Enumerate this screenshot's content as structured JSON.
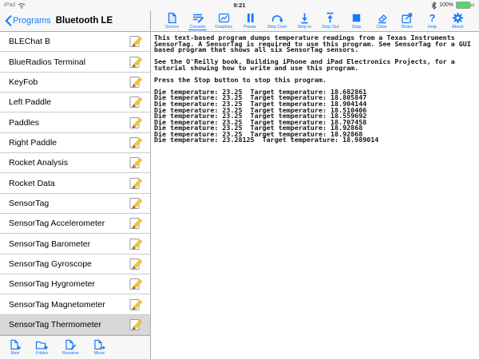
{
  "status_bar": {
    "device_label": "iPad",
    "time": "9:21",
    "battery_percent": "100%"
  },
  "nav": {
    "back_label": "Programs",
    "title": "Bluetooth LE"
  },
  "program_list": {
    "items": [
      {
        "label": "BLEChat B",
        "selected": false
      },
      {
        "label": "BlueRadios Terminal",
        "selected": false
      },
      {
        "label": "KeyFob",
        "selected": false
      },
      {
        "label": "Left Paddle",
        "selected": false
      },
      {
        "label": "Paddles",
        "selected": false
      },
      {
        "label": "Right Paddle",
        "selected": false
      },
      {
        "label": "Rocket Analysis",
        "selected": false
      },
      {
        "label": "Rocket Data",
        "selected": false
      },
      {
        "label": "SensorTag",
        "selected": false
      },
      {
        "label": "SensorTag Accelerometer",
        "selected": false
      },
      {
        "label": "SensorTag Barometer",
        "selected": false
      },
      {
        "label": "SensorTag Gyroscope",
        "selected": false
      },
      {
        "label": "SensorTag Hygrometer",
        "selected": false
      },
      {
        "label": "SensorTag Magnetometer",
        "selected": false
      },
      {
        "label": "SensorTag Thermometer",
        "selected": true
      }
    ],
    "row_edit_icon": "edit-program-icon"
  },
  "file_toolbar": {
    "items": [
      {
        "label": "New",
        "icon": "new-program-icon"
      },
      {
        "label": "Folder",
        "icon": "new-folder-icon"
      },
      {
        "label": "Rename",
        "icon": "rename-icon"
      },
      {
        "label": "Move",
        "icon": "move-icon"
      }
    ]
  },
  "run_toolbar": {
    "items": [
      {
        "label": "Source",
        "icon": "source-icon",
        "selected": false
      },
      {
        "label": "Console",
        "icon": "console-icon",
        "selected": true
      },
      {
        "label": "Graphics",
        "icon": "graphics-icon",
        "selected": false
      },
      {
        "label": "Pause",
        "icon": "pause-icon",
        "selected": false
      },
      {
        "label": "Step Over",
        "icon": "step-over-icon",
        "selected": false
      },
      {
        "label": "Step In",
        "icon": "step-in-icon",
        "selected": false
      },
      {
        "label": "Step Out",
        "icon": "step-out-icon",
        "selected": false
      },
      {
        "label": "Stop",
        "icon": "stop-icon",
        "selected": false
      },
      {
        "label": "Clear",
        "icon": "clear-icon",
        "selected": false
      },
      {
        "label": "Share",
        "icon": "share-icon",
        "selected": false
      },
      {
        "label": "Help",
        "icon": "help-icon",
        "selected": false
      },
      {
        "label": "About",
        "icon": "about-gear-icon",
        "selected": false
      }
    ]
  },
  "console": {
    "text": "This text-based program dumps temperature readings from a Texas Instruments\nSensorTag. A SensorTag is required to use this program. See SensorTag for a GUI\nbased program that shows all six SensorTag sensors.\n\nSee the O'Reilly book, Building iPhone and iPad Electronics Projects, for a\ntutorial showing how to write and use this program.\n\nPress the Stop button to stop this program.\n\nDie temperature: 23.25  Target temperature: 18.682861\nDie temperature: 23.25  Target temperature: 18.805847\nDie temperature: 23.25  Target temperature: 18.904144\nDie temperature: 23.25  Target temperature: 18.510406\nDie temperature: 23.25  Target temperature: 18.559692\nDie temperature: 23.25  Target temperature: 18.707458\nDie temperature: 23.25  Target temperature: 18.92868\nDie temperature: 23.25  Target temperature: 18.92868\nDie temperature: 23.28125  Target temperature: 18.989014"
  },
  "colors": {
    "accent_blue": "#1579fb",
    "toolbar_background": "#f7f7f7",
    "selected_row_background": "#d8d8d8",
    "row_separator": "#cbcacf",
    "panel_border": "#ababab",
    "battery_green": "#53d769",
    "pencil_yellow": "#f6c52e"
  }
}
